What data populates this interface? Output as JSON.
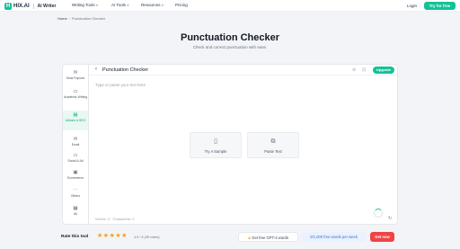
{
  "nav": {
    "logo_mark": "H",
    "logo_text": "HIX.AI",
    "logo_sub": "AI Writer",
    "menu": [
      "Writing Tools",
      "AI Tools",
      "Resources",
      "Pricing"
    ],
    "login": "Login",
    "try_free": "Try for free"
  },
  "breadcrumb": {
    "home": "Home",
    "separator": "›",
    "current": "Punctuation Checker"
  },
  "page": {
    "title": "Punctuation Checker",
    "subtitle": "Check and correct punctuation with ease."
  },
  "sidebar": {
    "items": [
      {
        "icon": "✉",
        "label": "Most Popular"
      },
      {
        "icon": "▭",
        "label": "Academic Writing"
      },
      {
        "icon": "▤",
        "label": "Articles & SEO",
        "active": true
      },
      {
        "icon": "✉",
        "label": "Email"
      },
      {
        "icon": "▭",
        "label": "Social & Ad"
      },
      {
        "icon": "▣",
        "label": "Ecommerce"
      },
      {
        "icon": "⋯",
        "label": "Others"
      },
      {
        "icon": "▦",
        "label": "All"
      }
    ]
  },
  "editor": {
    "back_icon": "‹",
    "title": "Punctuation Checker",
    "icons": [
      "⊘",
      "⊡"
    ],
    "upgrade": "Upgrade",
    "placeholder": "Type or paste your text here",
    "sample_icon": "▯",
    "sample_label": "Try A Sample",
    "paste_icon": "⧉",
    "paste_label": "Paste Text",
    "counts": "Words: 0 · Characters: 0",
    "refresh_icon": "↻"
  },
  "footer": {
    "rate_label": "Rate this tool",
    "stars": 5,
    "rating_text": "4.9 / 5 (39 votes)",
    "gpt_icon": "◈",
    "gpt_label": "Get free GPT-4 words",
    "words_label": "0/1,000 free words per week",
    "get_now": "Get now"
  },
  "colors": {
    "accent": "#13c296",
    "star": "#f59e0b",
    "cta_red": "#ef4444"
  }
}
